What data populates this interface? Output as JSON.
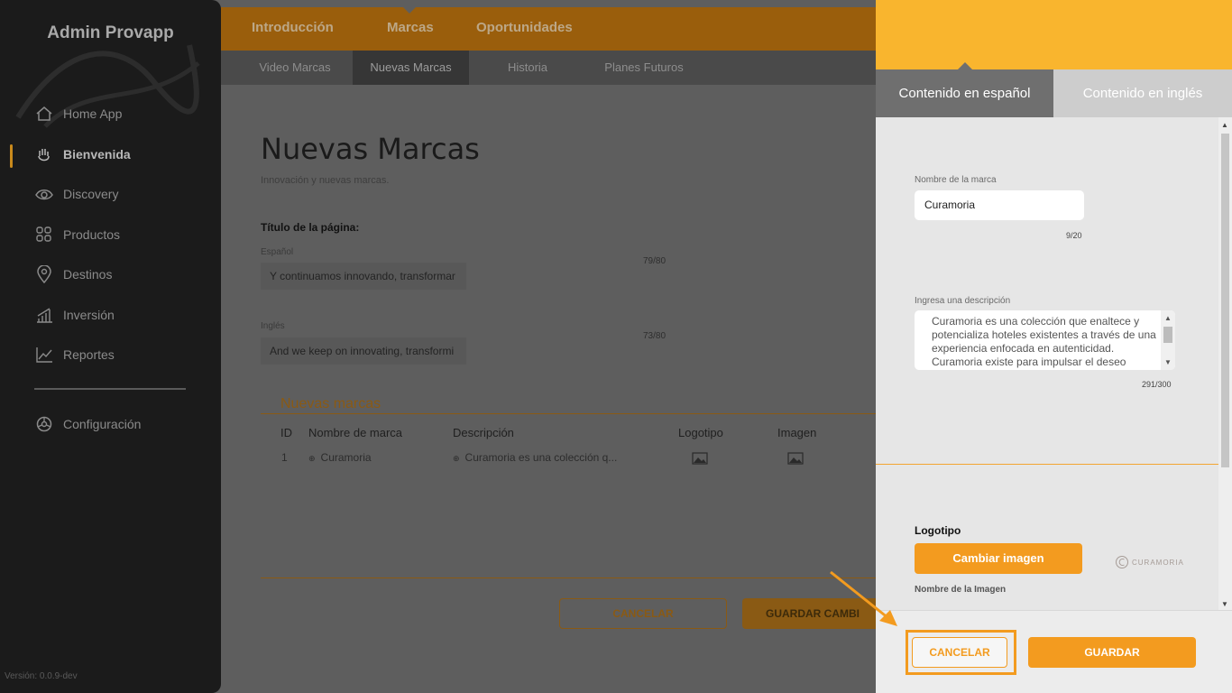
{
  "sidebar": {
    "brand": "Admin Provapp",
    "items": [
      {
        "label": "Home App",
        "icon": "home-icon"
      },
      {
        "label": "Bienvenida",
        "icon": "waving-hand-icon"
      },
      {
        "label": "Discovery",
        "icon": "eye-icon"
      },
      {
        "label": "Productos",
        "icon": "grid-icon"
      },
      {
        "label": "Destinos",
        "icon": "location-pin-icon"
      },
      {
        "label": "Inversión",
        "icon": "bar-chart-icon"
      },
      {
        "label": "Reportes",
        "icon": "line-chart-icon"
      },
      {
        "label": "Configuración",
        "icon": "settings-icon"
      }
    ],
    "version": "Versión: 0.0.9-dev"
  },
  "topnav": {
    "tabs": [
      "Introducción",
      "Marcas",
      "Oportunidades"
    ],
    "active": "Marcas"
  },
  "subnav": {
    "tabs": [
      "Video Marcas",
      "Nuevas Marcas",
      "Historia",
      "Planes Futuros"
    ],
    "active": "Nuevas Marcas"
  },
  "main": {
    "title": "Nuevas Marcas",
    "subtitle": "Innovación y nuevas marcas.",
    "page_title_label": "Título de la página:",
    "spanish_label": "Español",
    "spanish_value": "Y continuamos innovando, transformar",
    "spanish_count": "79/80",
    "english_label": "Inglés",
    "english_value": "And we keep on innovating, transformi",
    "english_count": "73/80",
    "section_title": "Nuevas marcas",
    "table": {
      "headers": [
        "ID",
        "Nombre de marca",
        "Descripción",
        "Logotipo",
        "Imagen"
      ],
      "rows": [
        {
          "id": "1",
          "name": "Curamoria",
          "description": "Curamoria es una colección q..."
        }
      ]
    },
    "cancel_label": "CANCELAR",
    "save_label": "GUARDAR CAMBI"
  },
  "panel": {
    "tab_spanish": "Contenido en español",
    "tab_english": "Contenido en inglés",
    "brand_name_label": "Nombre de la marca",
    "brand_name_value": "Curamoria",
    "brand_name_count": "9/20",
    "description_label": "Ingresa una descripción",
    "description_value": "Curamoria es una colección que enaltece y potencializa hoteles existentes a través de una experiencia enfocada en autenticidad. Curamoria existe para impulsar el deseo",
    "description_count": "291/300",
    "logo_label": "Logotipo",
    "change_image_label": "Cambiar imagen",
    "logo_thumb_text": "CURAMORIA",
    "image_name_label": "Nombre de la Imagen",
    "cancel_label": "CANCELAR",
    "save_label": "GUARDAR"
  },
  "colors": {
    "accent": "#f39b1f",
    "header_yellow": "#f9b52e",
    "sidebar_bg": "#1b1b1b",
    "overlay_bg": "#5e5e5e"
  }
}
